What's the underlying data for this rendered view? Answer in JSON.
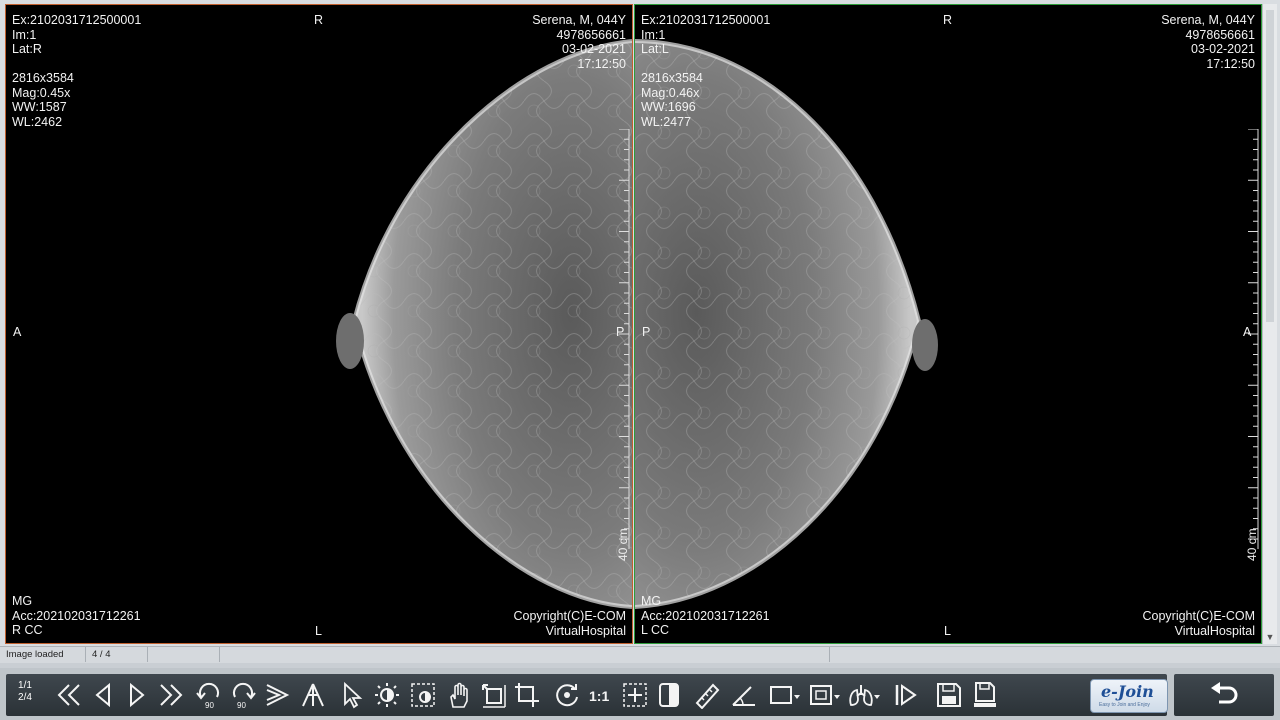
{
  "viewports": [
    {
      "id": "left",
      "top_left": [
        "Ex:2102031712500001",
        "Im:1",
        "Lat:R",
        "",
        "2816x3584",
        "Mag:0.45x",
        "WW:1587",
        "WL:2462"
      ],
      "top_center": "R",
      "top_right": [
        "Serena, M, 044Y",
        "4978656661",
        "03-02-2021",
        "17:12:50"
      ],
      "mid_left": "A",
      "mid_right": "P",
      "bottom_left": [
        "MG",
        "Acc:202102031712261",
        "R CC"
      ],
      "bottom_center": "L",
      "bottom_right": [
        "Copyright(C)E-COM",
        "VirtualHospital"
      ],
      "ruler_label": "40 cm",
      "frame_color": "#c0602f"
    },
    {
      "id": "right",
      "top_left": [
        "Ex:2102031712500001",
        "Im:1",
        "Lat:L",
        "",
        "2816x3584",
        "Mag:0.46x",
        "WW:1696",
        "WL:2477"
      ],
      "top_center": "R",
      "top_right": [
        "Serena, M, 044Y",
        "4978656661",
        "03-02-2021",
        "17:12:50"
      ],
      "mid_left": "P",
      "mid_right": "A",
      "bottom_left": [
        "MG",
        "Acc:202102031712261",
        "L CC"
      ],
      "bottom_center": "L",
      "bottom_right": [
        "Copyright(C)E-COM",
        "VirtualHospital"
      ],
      "ruler_label": "40 cm",
      "frame_color": "#2e9b3a"
    }
  ],
  "status": {
    "message": "Image loaded",
    "counter": "4 / 4"
  },
  "toolbar": {
    "page_top": "1/1",
    "page_bottom": "2/4",
    "tools": [
      {
        "name": "first-image",
        "icon": "double-chevron-left-icon"
      },
      {
        "name": "previous-image",
        "icon": "triangle-left-icon"
      },
      {
        "name": "next-image",
        "icon": "triangle-right-icon"
      },
      {
        "name": "last-image",
        "icon": "double-chevron-right-icon"
      },
      {
        "name": "rotate-left-90",
        "icon": "rotate-ccw-90-icon"
      },
      {
        "name": "rotate-right-90",
        "icon": "rotate-cw-90-icon"
      },
      {
        "name": "flip-horizontal",
        "icon": "flip-horizontal-icon"
      },
      {
        "name": "flip-vertical",
        "icon": "flip-vertical-icon"
      },
      {
        "name": "select",
        "icon": "cursor-arrow-icon"
      },
      {
        "name": "window-level",
        "icon": "brightness-icon"
      },
      {
        "name": "roi-window-level",
        "icon": "roi-brightness-icon"
      },
      {
        "name": "pan",
        "icon": "hand-icon"
      },
      {
        "name": "stretch",
        "icon": "stretch-icon"
      },
      {
        "name": "fit",
        "icon": "crop-fit-icon"
      },
      {
        "name": "reset",
        "icon": "reset-icon"
      },
      {
        "name": "actual-size",
        "icon": "one-to-one-icon"
      },
      {
        "name": "magnify",
        "icon": "magnify-dots-icon"
      },
      {
        "name": "invert",
        "icon": "invert-icon"
      },
      {
        "name": "measure-length",
        "icon": "ruler-icon"
      },
      {
        "name": "measure-angle",
        "icon": "angle-icon"
      },
      {
        "name": "rectangle-roi",
        "icon": "rectangle-icon"
      },
      {
        "name": "ellipse-roi",
        "icon": "square-roi-icon"
      },
      {
        "name": "layout",
        "icon": "lungs-icon"
      },
      {
        "name": "cine",
        "icon": "play-bar-icon"
      },
      {
        "name": "save",
        "icon": "floppy-icon"
      },
      {
        "name": "export",
        "icon": "floppy-export-icon"
      }
    ],
    "logo_text": "e-Join",
    "logo_sub": "Easy to Join and Enjoy"
  },
  "colors": {
    "toolbar_bg": "#2b3237",
    "left_frame": "#c0602f",
    "right_frame": "#2e9b3a"
  }
}
